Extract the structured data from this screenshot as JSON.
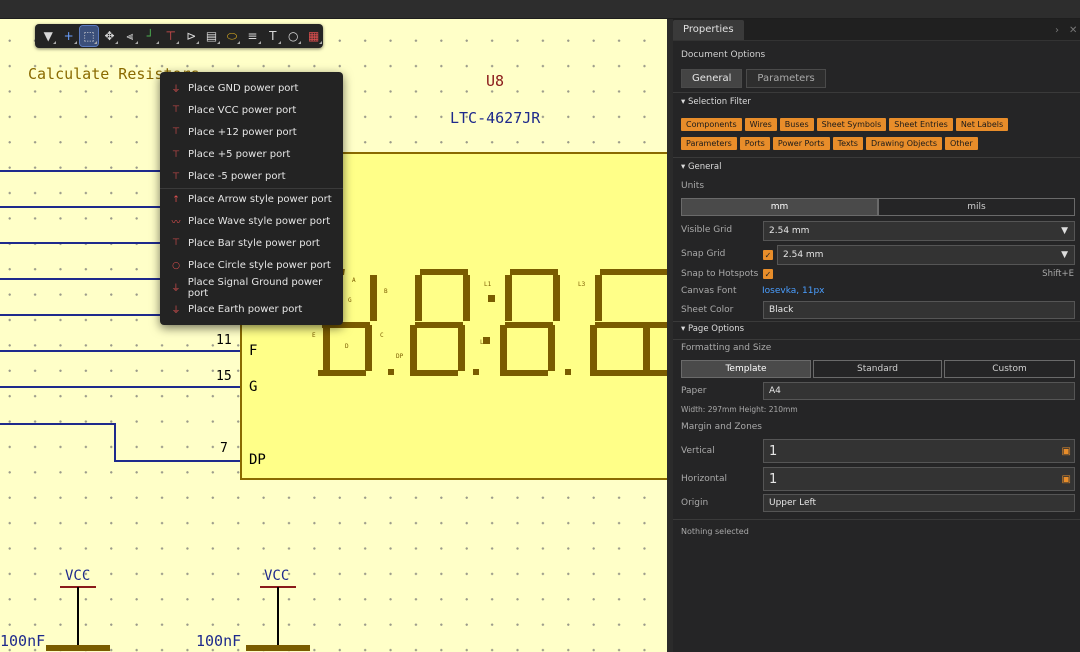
{
  "schematic": {
    "calc_text": "Calculate Resistors",
    "designator": "U8",
    "part": "LTC-4627JR",
    "pins": [
      {
        "num": "11",
        "name": "F"
      },
      {
        "num": "15",
        "name": "G"
      },
      {
        "num": "7",
        "name": "DP"
      }
    ],
    "seg_labels": {
      "a": "A",
      "b": "B",
      "c": "C",
      "d": "D",
      "e": "E",
      "g": "G",
      "dp": "DP",
      "l1": "L1",
      "l2": "L2",
      "l3": "L3"
    },
    "power_labels": [
      "VCC",
      "VCC"
    ],
    "cap_labels": [
      "100nF",
      "100nF"
    ]
  },
  "toolbar": {
    "icons": [
      "filter-icon",
      "plus-icon",
      "select-box-icon",
      "move-icon",
      "align-icon",
      "net-icon",
      "power-port-icon",
      "bus-entry-icon",
      "sheet-symbol-icon",
      "port-icon",
      "text-frame-icon",
      "text-icon",
      "shape-icon",
      "color-palette-icon"
    ]
  },
  "power_menu": {
    "items": [
      "Place GND power port",
      "Place VCC power port",
      "Place +12 power port",
      "Place +5 power port",
      "Place -5 power port",
      "Place Arrow style power port",
      "Place Wave style power port",
      "Place Bar style power port",
      "Place Circle style power port",
      "Place Signal Ground power port",
      "Place Earth power port"
    ]
  },
  "properties": {
    "tab": "Properties",
    "doc_options": "Document Options",
    "subtabs": [
      "General",
      "Parameters"
    ],
    "selection_filter": "Selection Filter",
    "filters_row1": [
      "Components",
      "Wires",
      "Buses",
      "Sheet Symbols",
      "Sheet Entries",
      "Net Labels"
    ],
    "filters_row2": [
      "Parameters",
      "Ports",
      "Power Ports",
      "Texts",
      "Drawing Objects",
      "Other"
    ],
    "general": "General",
    "units_label": "Units",
    "units": [
      "mm",
      "mils"
    ],
    "visible_grid_label": "Visible Grid",
    "visible_grid": "2.54 mm",
    "snap_grid_label": "Snap Grid",
    "snap_grid": "2.54 mm",
    "snap_hotspots_label": "Snap to Hotspots",
    "snap_shortcut": "Shift+E",
    "canvas_font_label": "Canvas Font",
    "canvas_font": "Iosevka, 11px",
    "sheet_color_label": "Sheet Color",
    "sheet_color": "Black",
    "page_options": "Page Options",
    "format_label": "Formatting and Size",
    "format_modes": [
      "Template",
      "Standard",
      "Custom"
    ],
    "paper_label": "Paper",
    "paper": "A4",
    "dims": "Width: 297mm  Height: 210mm",
    "margin_label": "Margin and Zones",
    "vertical_label": "Vertical",
    "vertical": "1",
    "horizontal_label": "Horizontal",
    "horizontal": "1",
    "origin_label": "Origin",
    "origin": "Upper Left",
    "nothing_selected": "Nothing selected"
  },
  "colors": {
    "accent": "#e88d2a",
    "sheet": "#ffffc8",
    "wire": "#1e2a8c",
    "segment": "#7a5c00",
    "symbol_border": "#8a6a00"
  }
}
